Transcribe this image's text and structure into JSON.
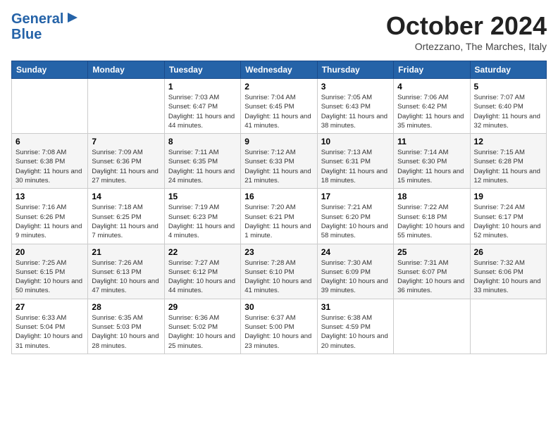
{
  "header": {
    "logo_line1": "General",
    "logo_line2": "Blue",
    "title": "October 2024",
    "subtitle": "Ortezzano, The Marches, Italy"
  },
  "days_of_week": [
    "Sunday",
    "Monday",
    "Tuesday",
    "Wednesday",
    "Thursday",
    "Friday",
    "Saturday"
  ],
  "weeks": [
    [
      {
        "day": "",
        "info": ""
      },
      {
        "day": "",
        "info": ""
      },
      {
        "day": "1",
        "info": "Sunrise: 7:03 AM\nSunset: 6:47 PM\nDaylight: 11 hours and 44 minutes."
      },
      {
        "day": "2",
        "info": "Sunrise: 7:04 AM\nSunset: 6:45 PM\nDaylight: 11 hours and 41 minutes."
      },
      {
        "day": "3",
        "info": "Sunrise: 7:05 AM\nSunset: 6:43 PM\nDaylight: 11 hours and 38 minutes."
      },
      {
        "day": "4",
        "info": "Sunrise: 7:06 AM\nSunset: 6:42 PM\nDaylight: 11 hours and 35 minutes."
      },
      {
        "day": "5",
        "info": "Sunrise: 7:07 AM\nSunset: 6:40 PM\nDaylight: 11 hours and 32 minutes."
      }
    ],
    [
      {
        "day": "6",
        "info": "Sunrise: 7:08 AM\nSunset: 6:38 PM\nDaylight: 11 hours and 30 minutes."
      },
      {
        "day": "7",
        "info": "Sunrise: 7:09 AM\nSunset: 6:36 PM\nDaylight: 11 hours and 27 minutes."
      },
      {
        "day": "8",
        "info": "Sunrise: 7:11 AM\nSunset: 6:35 PM\nDaylight: 11 hours and 24 minutes."
      },
      {
        "day": "9",
        "info": "Sunrise: 7:12 AM\nSunset: 6:33 PM\nDaylight: 11 hours and 21 minutes."
      },
      {
        "day": "10",
        "info": "Sunrise: 7:13 AM\nSunset: 6:31 PM\nDaylight: 11 hours and 18 minutes."
      },
      {
        "day": "11",
        "info": "Sunrise: 7:14 AM\nSunset: 6:30 PM\nDaylight: 11 hours and 15 minutes."
      },
      {
        "day": "12",
        "info": "Sunrise: 7:15 AM\nSunset: 6:28 PM\nDaylight: 11 hours and 12 minutes."
      }
    ],
    [
      {
        "day": "13",
        "info": "Sunrise: 7:16 AM\nSunset: 6:26 PM\nDaylight: 11 hours and 9 minutes."
      },
      {
        "day": "14",
        "info": "Sunrise: 7:18 AM\nSunset: 6:25 PM\nDaylight: 11 hours and 7 minutes."
      },
      {
        "day": "15",
        "info": "Sunrise: 7:19 AM\nSunset: 6:23 PM\nDaylight: 11 hours and 4 minutes."
      },
      {
        "day": "16",
        "info": "Sunrise: 7:20 AM\nSunset: 6:21 PM\nDaylight: 11 hours and 1 minute."
      },
      {
        "day": "17",
        "info": "Sunrise: 7:21 AM\nSunset: 6:20 PM\nDaylight: 10 hours and 58 minutes."
      },
      {
        "day": "18",
        "info": "Sunrise: 7:22 AM\nSunset: 6:18 PM\nDaylight: 10 hours and 55 minutes."
      },
      {
        "day": "19",
        "info": "Sunrise: 7:24 AM\nSunset: 6:17 PM\nDaylight: 10 hours and 52 minutes."
      }
    ],
    [
      {
        "day": "20",
        "info": "Sunrise: 7:25 AM\nSunset: 6:15 PM\nDaylight: 10 hours and 50 minutes."
      },
      {
        "day": "21",
        "info": "Sunrise: 7:26 AM\nSunset: 6:13 PM\nDaylight: 10 hours and 47 minutes."
      },
      {
        "day": "22",
        "info": "Sunrise: 7:27 AM\nSunset: 6:12 PM\nDaylight: 10 hours and 44 minutes."
      },
      {
        "day": "23",
        "info": "Sunrise: 7:28 AM\nSunset: 6:10 PM\nDaylight: 10 hours and 41 minutes."
      },
      {
        "day": "24",
        "info": "Sunrise: 7:30 AM\nSunset: 6:09 PM\nDaylight: 10 hours and 39 minutes."
      },
      {
        "day": "25",
        "info": "Sunrise: 7:31 AM\nSunset: 6:07 PM\nDaylight: 10 hours and 36 minutes."
      },
      {
        "day": "26",
        "info": "Sunrise: 7:32 AM\nSunset: 6:06 PM\nDaylight: 10 hours and 33 minutes."
      }
    ],
    [
      {
        "day": "27",
        "info": "Sunrise: 6:33 AM\nSunset: 5:04 PM\nDaylight: 10 hours and 31 minutes."
      },
      {
        "day": "28",
        "info": "Sunrise: 6:35 AM\nSunset: 5:03 PM\nDaylight: 10 hours and 28 minutes."
      },
      {
        "day": "29",
        "info": "Sunrise: 6:36 AM\nSunset: 5:02 PM\nDaylight: 10 hours and 25 minutes."
      },
      {
        "day": "30",
        "info": "Sunrise: 6:37 AM\nSunset: 5:00 PM\nDaylight: 10 hours and 23 minutes."
      },
      {
        "day": "31",
        "info": "Sunrise: 6:38 AM\nSunset: 4:59 PM\nDaylight: 10 hours and 20 minutes."
      },
      {
        "day": "",
        "info": ""
      },
      {
        "day": "",
        "info": ""
      }
    ]
  ]
}
